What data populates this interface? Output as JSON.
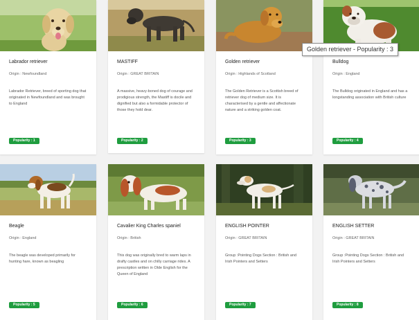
{
  "breeds": [
    {
      "name": "Labrador retriever",
      "origin": "Origin : Newfoundland",
      "description": "Labrador Retriever, breed of sporting dog that originated in Newfoundland and was brought to England",
      "popularity": "Popularity : 1",
      "photo": "yellow-labrador-photo"
    },
    {
      "name": "MASTIFF",
      "origin": "Origin : GREAT BRITAIN",
      "description": "A massive, heavy-boned dog of courage and prodigious strength, the Mastiff is docile and dignified but also a formidable protector of those they hold dear.",
      "popularity": "Popularity : 2",
      "photo": "brindle-mastiff-photo"
    },
    {
      "name": "Golden retriever",
      "origin": "Origin : Highlands of Scotland",
      "description": "The Golden Retriever is a Scottish breed of retriever dog of medium size. It is characterised by a gentle and affectionate nature and a striking golden coat.",
      "popularity": "Popularity : 3",
      "photo": "golden-retriever-photo"
    },
    {
      "name": "Bulldog",
      "origin": "Origin : England",
      "description": "The Bulldog originated in England and has a longstanding association with British culture",
      "popularity": "Popularity : 4",
      "photo": "bulldog-photo"
    },
    {
      "name": "Beagle",
      "origin": "Origin : England",
      "description": "The beagle was developed primarily for hunting hare, known as beagling",
      "popularity": "Popularity : 5",
      "photo": "beagle-photo"
    },
    {
      "name": "Cavalier King Charles spaniel",
      "origin": "Origin : British",
      "description": "This dog was originally bred to warm laps in drafty castles and on chilly carriage rides. A prescription written in Olde English for the Queen of England",
      "popularity": "Popularity : 6",
      "photo": "cavalier-spaniel-photo"
    },
    {
      "name": "ENGLISH POINTER",
      "origin": "Origin : GREAT BRITAIN",
      "description": "Group :Pointing Dogs Section : British and Irish Pointers and Setters",
      "popularity": "Popularity : 7",
      "photo": "english-pointer-photo"
    },
    {
      "name": "ENGLISH SETTER",
      "origin": "Origin : GREAT BRITAIN",
      "description": "Group :Pointing Dogs Section : British and Irish Pointers and Setters",
      "popularity": "Popularity : 8",
      "photo": "english-setter-photo"
    }
  ],
  "tooltip": {
    "text": "Golden retriever - Popularity : 3"
  },
  "colors": {
    "badge": "#1f9d3f",
    "background": "#f2f2f2",
    "card": "#ffffff"
  }
}
